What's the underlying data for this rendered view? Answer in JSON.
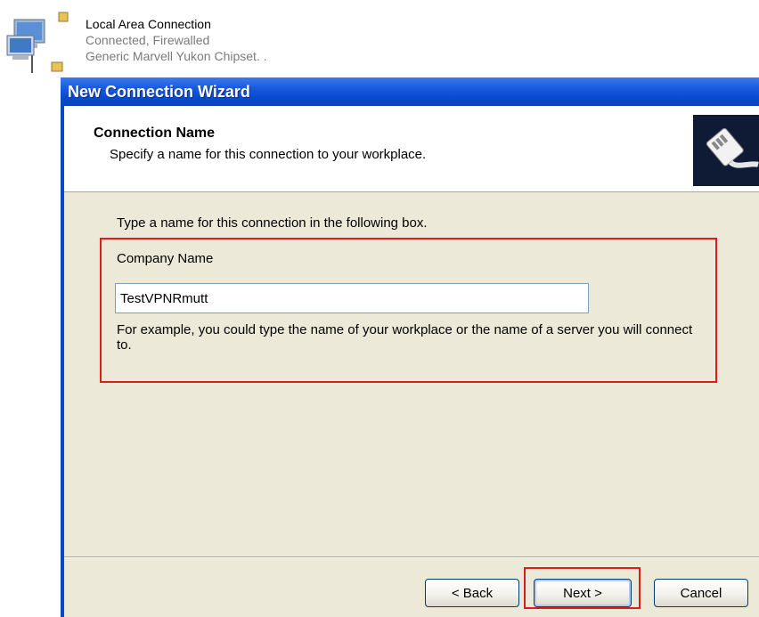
{
  "connection_item": {
    "name": "Local Area Connection",
    "status": "Connected, Firewalled",
    "device": "Generic Marvell Yukon Chipset. .",
    "icon": "network-computers-icon"
  },
  "wizard": {
    "title": "New Connection Wizard",
    "header": {
      "title": "Connection Name",
      "subtitle": "Specify a name for this connection to your workplace.",
      "icon": "network-cable-icon"
    },
    "instruction": "Type a name for this connection in the following box.",
    "field_label": "Company Name",
    "field_value": "TestVPNRmutt",
    "example_text": "For example, you could type the name of your workplace or the name of a server you will connect to.",
    "buttons": {
      "back": "< Back",
      "next": "Next >",
      "cancel": "Cancel"
    }
  },
  "colors": {
    "titlebar": "#0a49d2",
    "client_bg": "#ece9d8",
    "highlight": "#e11b1b"
  }
}
